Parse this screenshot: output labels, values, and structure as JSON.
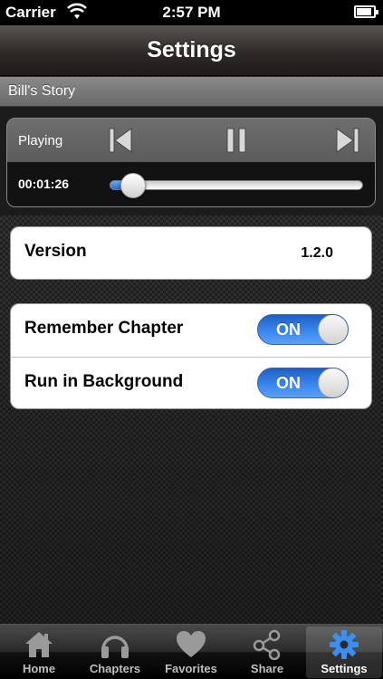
{
  "status_bar": {
    "carrier": "Carrier",
    "time": "2:57 PM"
  },
  "nav": {
    "title": "Settings"
  },
  "story": {
    "title": "Bill's Story"
  },
  "player": {
    "status": "Playing",
    "elapsed": "00:01:26",
    "progress": 0.09
  },
  "settings": {
    "version_label": "Version",
    "version_value": "1.2.0",
    "toggles": [
      {
        "label": "Remember Chapter",
        "state": "ON"
      },
      {
        "label": "Run in Background",
        "state": "ON"
      }
    ]
  },
  "tabs": [
    {
      "label": "Home",
      "icon": "home-icon"
    },
    {
      "label": "Chapters",
      "icon": "headphones-icon"
    },
    {
      "label": "Favorites",
      "icon": "heart-icon"
    },
    {
      "label": "Share",
      "icon": "share-icon"
    },
    {
      "label": "Settings",
      "icon": "gear-icon",
      "active": true
    }
  ],
  "colors": {
    "accent": "#2f7be6",
    "tab_active_icon": "#3b8ff0"
  }
}
